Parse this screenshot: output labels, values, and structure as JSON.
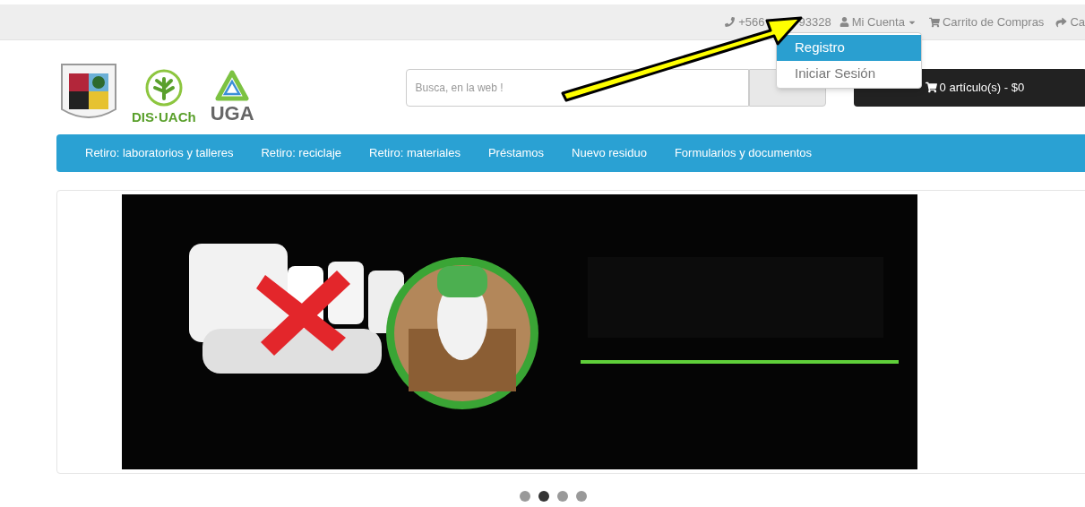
{
  "top_bar": {
    "phone_parts": [
      "+566",
      "93328"
    ],
    "account": "Mi Cuenta",
    "cart_link": "Carrito de Compras",
    "checkout_link": "Ca"
  },
  "account_menu": [
    {
      "label": "Registro",
      "selected": true
    },
    {
      "label": "Iniciar Sesión",
      "selected": false
    }
  ],
  "logos": {
    "dis": "DIS·UACh",
    "uga": "UGA"
  },
  "search": {
    "placeholder": "Busca, en la web !"
  },
  "cart_button": "0 artículo(s) - $0",
  "nav": [
    "Retiro: laboratorios y talleres",
    "Retiro: reciclaje",
    "Retiro: materiales",
    "Préstamos",
    "Nuevo residuo",
    "Formularios y documentos"
  ],
  "carousel_dots": [
    {
      "selected": false
    },
    {
      "selected": true
    },
    {
      "selected": false
    },
    {
      "selected": false
    }
  ]
}
